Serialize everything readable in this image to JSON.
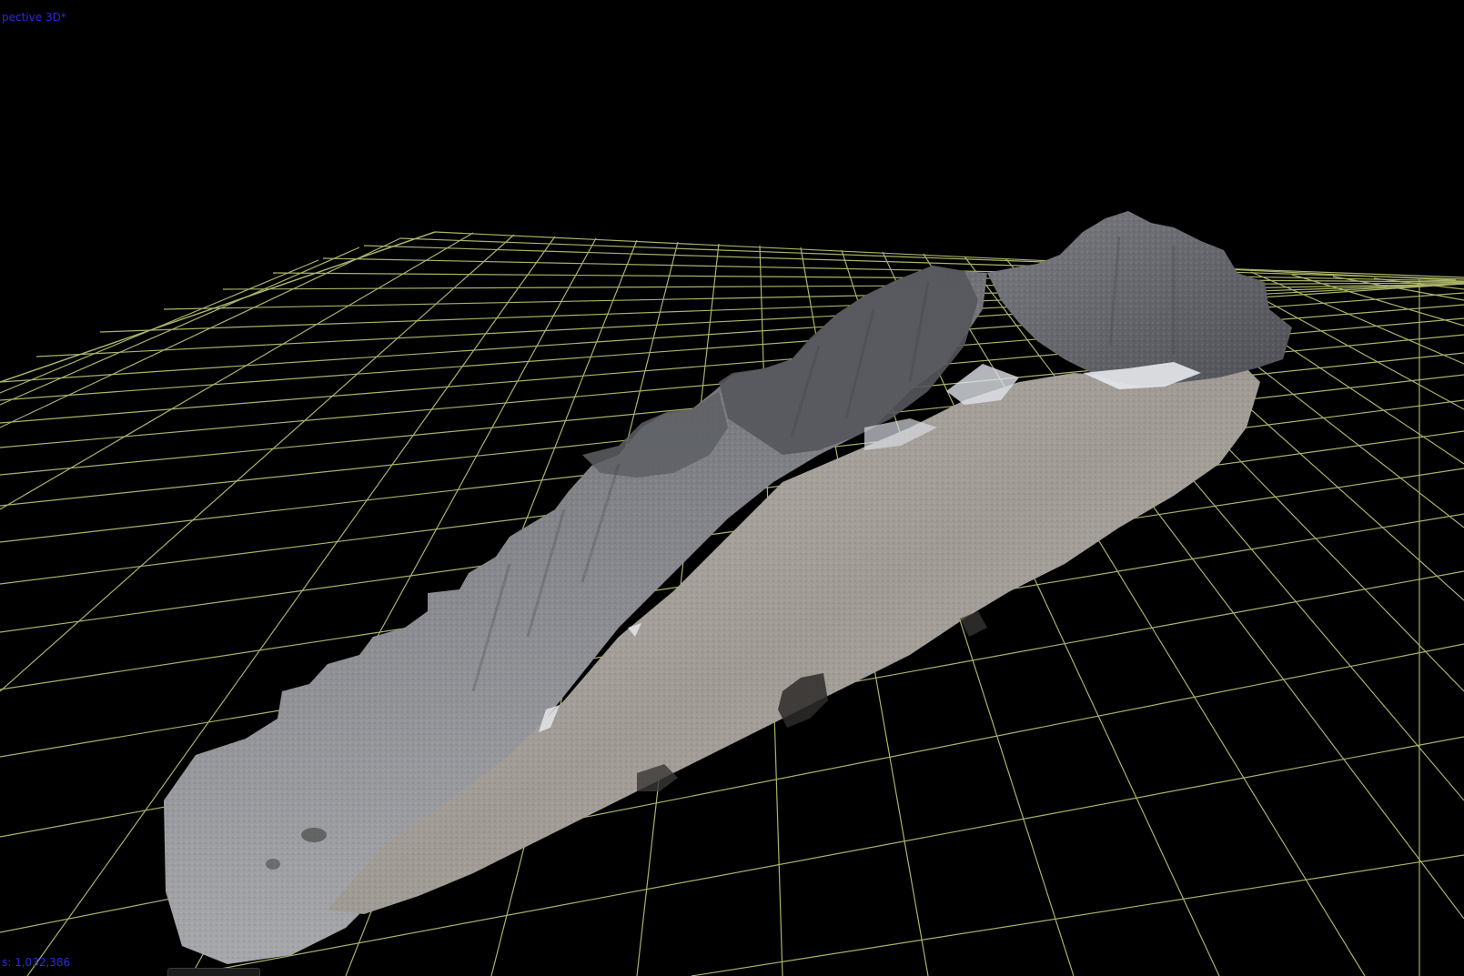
{
  "viewport": {
    "view_mode_label": "pective 3D*",
    "point_count_label": "s: 1,032,386",
    "background_color": "#000000",
    "grid_color": "#c8d27a"
  },
  "scene": {
    "subject": "photogrammetry-point-cloud-rock-ridge",
    "ground_plane": "grid"
  }
}
